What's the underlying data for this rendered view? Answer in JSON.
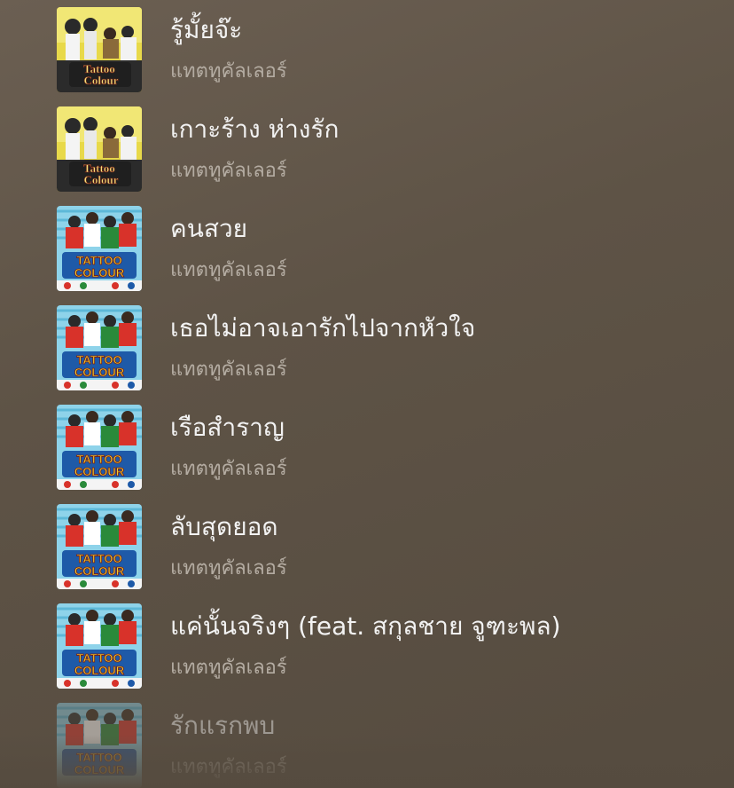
{
  "songs": [
    {
      "title": "รู้มั้ยจ๊ะ",
      "artist": "แทตทูคัลเลอร์",
      "album_art": "album-art-tattoo-colour-yellow"
    },
    {
      "title": "เกาะร้าง ห่างรัก",
      "artist": "แทตทูคัลเลอร์",
      "album_art": "album-art-tattoo-colour-yellow"
    },
    {
      "title": "คนสวย",
      "artist": "แทตทูคัลเลอร์",
      "album_art": "album-art-tattoo-colour-blue"
    },
    {
      "title": "เธอไม่อาจเอารักไปจากหัวใจ",
      "artist": "แทตทูคัลเลอร์",
      "album_art": "album-art-tattoo-colour-blue"
    },
    {
      "title": "เรือสำราญ",
      "artist": "แทตทูคัลเลอร์",
      "album_art": "album-art-tattoo-colour-blue"
    },
    {
      "title": "ลับสุดยอด",
      "artist": "แทตทูคัลเลอร์",
      "album_art": "album-art-tattoo-colour-blue"
    },
    {
      "title": "แค่นั้นจริงๆ (feat. สกุลชาย จูฑะพล)",
      "artist": "แทตทูคัลเลอร์",
      "album_art": "album-art-tattoo-colour-blue"
    },
    {
      "title": "รักแรกพบ",
      "artist": "แทตทูคัลเลอร์",
      "album_art": "album-art-tattoo-colour-blue"
    }
  ],
  "art_logo_text": "Tattoo Colour",
  "colors": {
    "background": "#5e5346",
    "title_text": "#f2f2f2",
    "artist_text": "#b4aca2"
  }
}
